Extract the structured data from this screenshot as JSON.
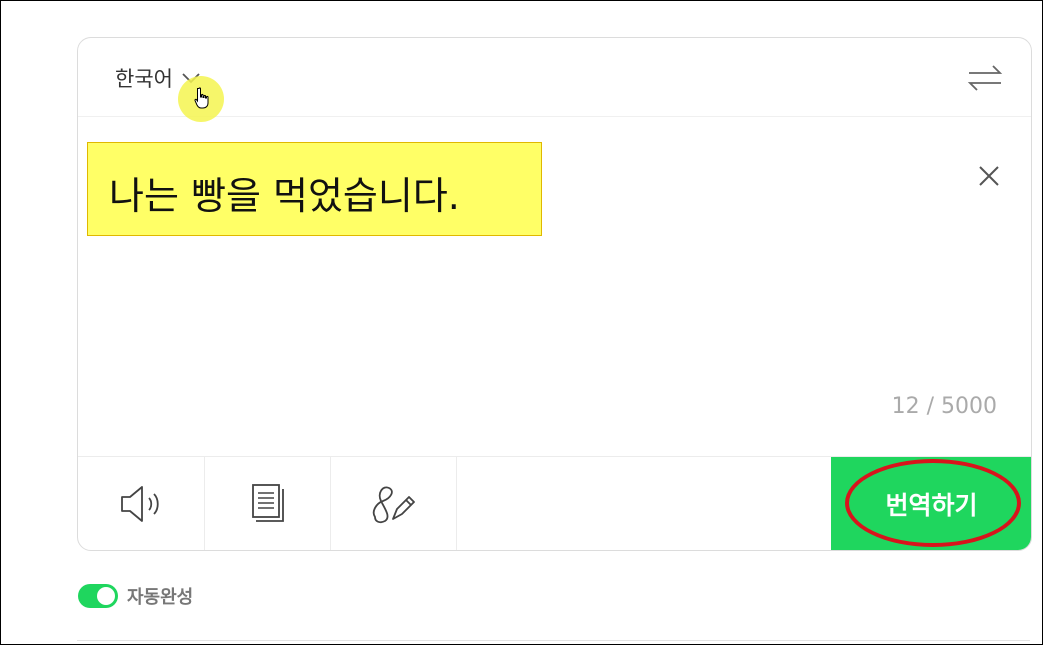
{
  "source_lang": {
    "label": "한국어",
    "icon": "chevron-down-icon"
  },
  "swap": {
    "icon": "swap-arrows-icon"
  },
  "input": {
    "text": "나는 빵을 먹었습니다.",
    "highlight_color": "#ffff66",
    "clear_icon": "close-icon"
  },
  "counter": "12 / 5000",
  "toolbar": {
    "listen_icon": "speaker-icon",
    "dictionary_icon": "document-icon",
    "handwriting_icon": "pen-icon"
  },
  "translate_button": {
    "label": "번역하기",
    "color": "#1fd65e",
    "annotation_color": "#d8141c"
  },
  "autocomplete": {
    "label": "자동완성",
    "enabled": true
  }
}
